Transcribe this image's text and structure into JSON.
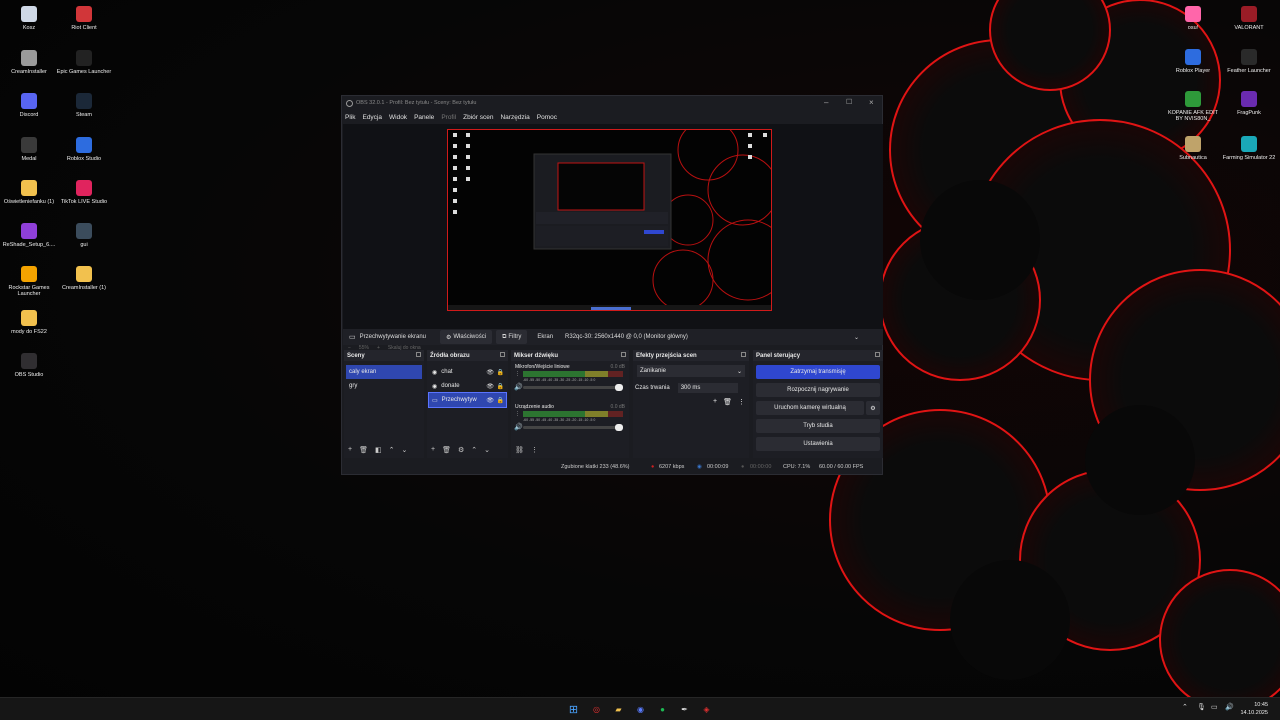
{
  "desktop": {
    "left_icons": [
      {
        "label": "Kosz",
        "icon": "recycle-bin-icon",
        "color": "#cfd8e6"
      },
      {
        "label": "Riot Client",
        "icon": "riot-client-icon",
        "color": "#d13639"
      },
      {
        "label": "CreamInstaller",
        "icon": "gear-icon",
        "color": "#9a9a9a"
      },
      {
        "label": "Epic Games Launcher",
        "icon": "epic-games-icon",
        "color": "#222222"
      },
      {
        "label": "Discord",
        "icon": "discord-icon",
        "color": "#5865f2"
      },
      {
        "label": "Steam",
        "icon": "steam-icon",
        "color": "#1b2838"
      },
      {
        "label": "Medal",
        "icon": "medal-icon",
        "color": "#3a3a3a"
      },
      {
        "label": "Roblox Studio",
        "icon": "roblox-studio-icon",
        "color": "#2d6cdf"
      },
      {
        "label": "Oświetleniefanku (1)",
        "icon": "folder-icon",
        "color": "#f2c14e"
      },
      {
        "label": "TikTok LIVE Studio",
        "icon": "tiktok-icon",
        "color": "#e0245e"
      },
      {
        "label": "ReShade_Setup_6....",
        "icon": "reshade-icon",
        "color": "#8f3fd9"
      },
      {
        "label": "gui",
        "icon": "gui-icon",
        "color": "#3b4c5c"
      },
      {
        "label": "Rockstar Games Launcher",
        "icon": "rockstar-icon",
        "color": "#f4a300"
      },
      {
        "label": "CreamInstaller (1)",
        "icon": "folder-icon",
        "color": "#f2c14e"
      },
      {
        "label": "mody do FS22",
        "icon": "folder-icon",
        "color": "#f2c14e"
      },
      {
        "label": "OBS Studio",
        "icon": "obs-icon",
        "color": "#302e31"
      }
    ],
    "right_icons": [
      {
        "label": "osu!",
        "icon": "osu-icon",
        "color": "#ff66aa"
      },
      {
        "label": "VALORANT",
        "icon": "valorant-icon",
        "color": "#9a1c26"
      },
      {
        "label": "Roblox Player",
        "icon": "roblox-icon",
        "color": "#2d6cdf"
      },
      {
        "label": "Feather Launcher",
        "icon": "feather-icon",
        "color": "#2a2a2a"
      },
      {
        "label": "KOPANIE AFK EDIT BY NVIS80N_",
        "icon": "kopanie-icon",
        "color": "#2e9a3a"
      },
      {
        "label": "FragPunk",
        "icon": "fragpunk-icon",
        "color": "#6a2bb0"
      },
      {
        "label": "Subnautica",
        "icon": "subnautica-icon",
        "color": "#bfa36a"
      },
      {
        "label": "Farming Simulator 22",
        "icon": "farming-simulator-icon",
        "color": "#1aa8b8"
      }
    ]
  },
  "obs": {
    "title": "OBS 32.0.1 - Profil: Bez tytułu - Sceny: Bez tytułu",
    "menu": [
      "Plik",
      "Edycja",
      "Widok",
      "Panele",
      "Profil",
      "Zbiór scen",
      "Narzędzia",
      "Pomoc"
    ],
    "zoom": {
      "minus": "−",
      "value": "55%",
      "plus": "+",
      "fit": "Skaluj do okna"
    },
    "source_toolbar": {
      "source_name": "Przechwytywanie ekranu",
      "properties": "Właściwości",
      "filters": "Filtry",
      "screen_label": "Ekran",
      "screen_value": "R32qc-30: 2560x1440 @ 0,0 (Monitor główny)"
    },
    "scenes": {
      "title": "Sceny",
      "items": [
        "caly ekran",
        "gry"
      ],
      "selected_index": 0
    },
    "sources": {
      "title": "Źródła obrazu",
      "items": [
        {
          "name": "chat",
          "icon": "browser-source-icon"
        },
        {
          "name": "donate",
          "icon": "browser-source-icon"
        },
        {
          "name": "Przechwytyw",
          "icon": "display-capture-icon"
        }
      ],
      "selected_index": 2
    },
    "mixer": {
      "title": "Mikser dźwięku",
      "channels": [
        {
          "name": "Mikrofon/Wejście liniowe",
          "db": "0.0 dB",
          "level": 0.62
        },
        {
          "name": "Urządzenie audio",
          "db": "0.0 dB",
          "level": 0.55
        }
      ],
      "scale": "-60 -55 -50 -45 -40 -35 -30 -25 -20 -15 -10 -5 0"
    },
    "transitions": {
      "title": "Efekty przejścia scen",
      "type": "Zanikanie",
      "duration_label": "Czas trwania",
      "duration_value": "300 ms"
    },
    "controls": {
      "title": "Panel sterujący",
      "stop_stream": "Zatrzymaj transmisję",
      "start_record": "Rozpocznij nagrywanie",
      "virtual_cam": "Uruchom kamerę wirtualną",
      "studio_mode": "Tryb studia",
      "settings": "Ustawienia"
    },
    "status": {
      "dropped": "Zgubione klatki 233 (48.6%)",
      "bitrate": "6207 kbps",
      "stream_time": "00:00:09",
      "rec_time": "00:00:00",
      "cpu": "CPU: 7.1%",
      "fps": "60.00 / 60.00 FPS"
    },
    "colors": {
      "accent": "#2f47d0",
      "selection_border": "#d01a1a"
    }
  },
  "taskbar": {
    "time": "10:45",
    "date": "14.10.2025"
  }
}
